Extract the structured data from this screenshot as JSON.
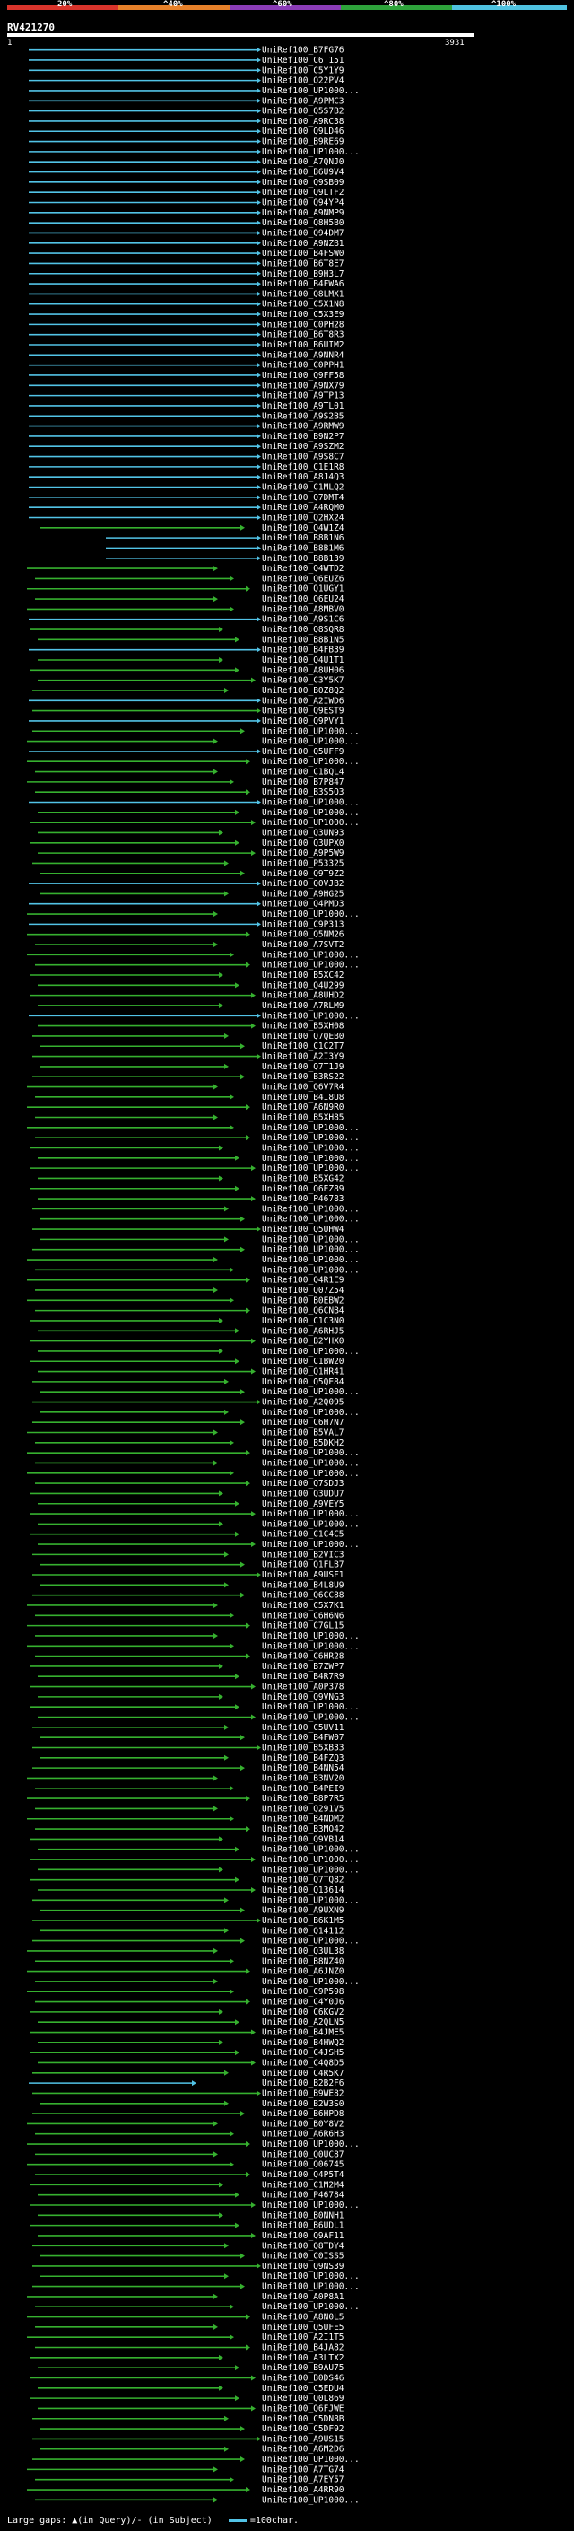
{
  "legend": {
    "labels": [
      "20%",
      "^40%",
      "^60%",
      "^80%",
      "^100%"
    ],
    "colors": [
      "#d9342b",
      "#e7812a",
      "#8b3cb7",
      "#2ea33b",
      "#4fc2e0"
    ]
  },
  "query": {
    "id": "RV421270",
    "start": "1",
    "end": "3931"
  },
  "footer": {
    "gaps": "Large gaps: ▲(in Query)/- (in Subject)",
    "scale": "=100char."
  },
  "hits": [
    "UniRef100_B7FG76",
    "UniRef100_C6T151",
    "UniRef100_C5Y1Y9",
    "UniRef100_Q22PV4",
    "UniRef100_UP1000...",
    "UniRef100_A9PMC3",
    "UniRef100_Q5S7B2",
    "UniRef100_A9RC38",
    "UniRef100_Q9LD46",
    "UniRef100_B9RE69",
    "UniRef100_UP1000...",
    "UniRef100_A7QNJ0",
    "UniRef100_B6U9V4",
    "UniRef100_Q9SB09",
    "UniRef100_Q9LTF2",
    "UniRef100_Q94YP4",
    "UniRef100_A9NMP9",
    "UniRef100_Q8H5B0",
    "UniRef100_Q94DM7",
    "UniRef100_A9NZB1",
    "UniRef100_B4FSW0",
    "UniRef100_B6T8E7",
    "UniRef100_B9H3L7",
    "UniRef100_B4FWA6",
    "UniRef100_Q8LMX1",
    "UniRef100_C5X1N8",
    "UniRef100_C5X3E9",
    "UniRef100_C0PH28",
    "UniRef100_B6T8R3",
    "UniRef100_B6UIM2",
    "UniRef100_A9NNR4",
    "UniRef100_C0PPH1",
    "UniRef100_Q9FF58",
    "UniRef100_A9NX79",
    "UniRef100_A9TP13",
    "UniRef100_A9TL01",
    "UniRef100_A9S2B5",
    "UniRef100_A9RMW9",
    "UniRef100_B9N2P7",
    "UniRef100_A9SZM2",
    "UniRef100_A9S8C7",
    "UniRef100_C1E1R8",
    "UniRef100_A8J4Q3",
    "UniRef100_C1MLQ2",
    "UniRef100_Q7DMT4",
    "UniRef100_A4RQM0",
    "UniRef100_Q2HX24",
    "UniRef100_Q4W1Z4",
    "UniRef100_B8B1N6",
    "UniRef100_B8B1M6",
    "UniRef100_B8B139",
    "UniRef100_Q4WTD2",
    "UniRef100_Q6EUZ6",
    "UniRef100_Q1UGY1",
    "UniRef100_Q6EU24",
    "UniRef100_A8MBV0",
    "UniRef100_A9S1C6",
    "UniRef100_Q8SQR8",
    "UniRef100_B8B1N5",
    "UniRef100_B4FB39",
    "UniRef100_Q4U1T1",
    "UniRef100_A8UH06",
    "UniRef100_C3Y5K7",
    "UniRef100_B0Z8Q2",
    "UniRef100_A2IWD6",
    "UniRef100_Q9EST9",
    "UniRef100_Q9PVY1",
    "UniRef100_UP1000...",
    "UniRef100_UP1000...",
    "UniRef100_Q5UFF9",
    "UniRef100_UP1000...",
    "UniRef100_C1BQL4",
    "UniRef100_B7P847",
    "UniRef100_B3S5Q3",
    "UniRef100_UP1000...",
    "UniRef100_UP1000...",
    "UniRef100_UP1000...",
    "UniRef100_Q3UN93",
    "UniRef100_Q3UPX0",
    "UniRef100_A9P5W9",
    "UniRef100_P53325",
    "UniRef100_Q9T9Z2",
    "UniRef100_Q0VJB2",
    "UniRef100_A9HG25",
    "UniRef100_Q4PMD3",
    "UniRef100_UP1000...",
    "UniRef100_C9P313",
    "UniRef100_Q5NM26",
    "UniRef100_A7SVT2",
    "UniRef100_UP1000...",
    "UniRef100_UP1000...",
    "UniRef100_B5XC42",
    "UniRef100_Q4U299",
    "UniRef100_A8UHD2",
    "UniRef100_A7RLM9",
    "UniRef100_UP1000...",
    "UniRef100_B5XH08",
    "UniRef100_Q7QEB0",
    "UniRef100_C1C2T7",
    "UniRef100_A2I3Y9",
    "UniRef100_Q7T1J9",
    "UniRef100_B3RS22",
    "UniRef100_Q6V7R4",
    "UniRef100_B4I8U8",
    "UniRef100_A6N9R0",
    "UniRef100_B5XH85",
    "UniRef100_UP1000...",
    "UniRef100_UP1000...",
    "UniRef100_UP1000...",
    "UniRef100_UP1000...",
    "UniRef100_UP1000...",
    "UniRef100_B5XG42",
    "UniRef100_Q6EZ89",
    "UniRef100_P46783",
    "UniRef100_UP1000...",
    "UniRef100_UP1000...",
    "UniRef100_Q5UHW4",
    "UniRef100_UP1000...",
    "UniRef100_UP1000...",
    "UniRef100_UP1000...",
    "UniRef100_UP1000...",
    "UniRef100_Q4R1E9",
    "UniRef100_Q07Z54",
    "UniRef100_B0EBW2",
    "UniRef100_Q6CNB4",
    "UniRef100_C1C3N0",
    "UniRef100_A6RHJ5",
    "UniRef100_B2YHX0",
    "UniRef100_UP1000...",
    "UniRef100_C1BW20",
    "UniRef100_Q1HR41",
    "UniRef100_Q5QE84",
    "UniRef100_UP1000...",
    "UniRef100_A2Q095",
    "UniRef100_UP1000...",
    "UniRef100_C6H7N7",
    "UniRef100_B5VAL7",
    "UniRef100_B5DKH2",
    "UniRef100_UP1000...",
    "UniRef100_UP1000...",
    "UniRef100_UP1000...",
    "UniRef100_Q7SDJ3",
    "UniRef100_Q3UDU7",
    "UniRef100_A9VEY5",
    "UniRef100_UP1000...",
    "UniRef100_UP1000...",
    "UniRef100_C1C4C5",
    "UniRef100_UP1000...",
    "UniRef100_B2VIC3",
    "UniRef100_Q1FLB7",
    "UniRef100_A9USF1",
    "UniRef100_B4L8U9",
    "UniRef100_Q6CC88",
    "UniRef100_C5X7K1",
    "UniRef100_C6H6N6",
    "UniRef100_C7GL15",
    "UniRef100_UP1000...",
    "UniRef100_UP1000...",
    "UniRef100_C6HR28",
    "UniRef100_B7ZWP7",
    "UniRef100_B4R7R9",
    "UniRef100_A0P378",
    "UniRef100_Q9VNG3",
    "UniRef100_UP1000...",
    "UniRef100_UP1000...",
    "UniRef100_C5UV11",
    "UniRef100_B4FW07",
    "UniRef100_B5XB33",
    "UniRef100_B4FZQ3",
    "UniRef100_B4NN54",
    "UniRef100_B3NV20",
    "UniRef100_B4PEI9",
    "UniRef100_B8P7R5",
    "UniRef100_Q291V5",
    "UniRef100_B4NDM2",
    "UniRef100_B3MQ42",
    "UniRef100_Q9VB14",
    "UniRef100_UP1000...",
    "UniRef100_UP1000...",
    "UniRef100_UP1000...",
    "UniRef100_Q7TQ82",
    "UniRef100_Q13614",
    "UniRef100_UP1000...",
    "UniRef100_A9UXN9",
    "UniRef100_B6K1M5",
    "UniRef100_Q14112",
    "UniRef100_UP1000...",
    "UniRef100_Q3UL38",
    "UniRef100_B8NZ40",
    "UniRef100_A6JNZ0",
    "UniRef100_UP1000...",
    "UniRef100_C9P598",
    "UniRef100_C4Y0J6",
    "UniRef100_C6KGV2",
    "UniRef100_A2QLN5",
    "UniRef100_B4JME5",
    "UniRef100_B4HWQ2",
    "UniRef100_C4JSH5",
    "UniRef100_C4Q8D5",
    "UniRef100_C4R5K7",
    "UniRef100_B2B2F6",
    "UniRef100_B9WE82",
    "UniRef100_B2W3S0",
    "UniRef100_B6HPD8",
    "UniRef100_B0Y8V2",
    "UniRef100_A6R6H3",
    "UniRef100_UP1000...",
    "UniRef100_Q0UC87",
    "UniRef100_Q06745",
    "UniRef100_Q4P5T4",
    "UniRef100_C1M2M4",
    "UniRef100_P46784",
    "UniRef100_UP1000...",
    "UniRef100_B0NNH1",
    "UniRef100_B6UDL1",
    "UniRef100_Q9AF11",
    "UniRef100_Q8TDY4",
    "UniRef100_C0ISS5",
    "UniRef100_Q9NS39",
    "UniRef100_UP1000...",
    "UniRef100_UP1000...",
    "UniRef100_A0P8A1",
    "UniRef100_UP1000...",
    "UniRef100_A8N0L5",
    "UniRef100_Q5UFE5",
    "UniRef100_A2I1T5",
    "UniRef100_B4JA82",
    "UniRef100_A3LTX2",
    "UniRef100_B9AU75",
    "UniRef100_B0DS46",
    "UniRef100_C5EDU4",
    "UniRef100_Q0L869",
    "UniRef100_Q6FJWE",
    "UniRef100_C5DN8B",
    "UniRef100_C5DF92",
    "UniRef100_A9US15",
    "UniRef100_A6M2D6",
    "UniRef100_UP1000...",
    "UniRef100_A7TG74",
    "UniRef100_A7EY57",
    "UniRef100_A4RR90",
    "UniRef100_UP1000..."
  ]
}
